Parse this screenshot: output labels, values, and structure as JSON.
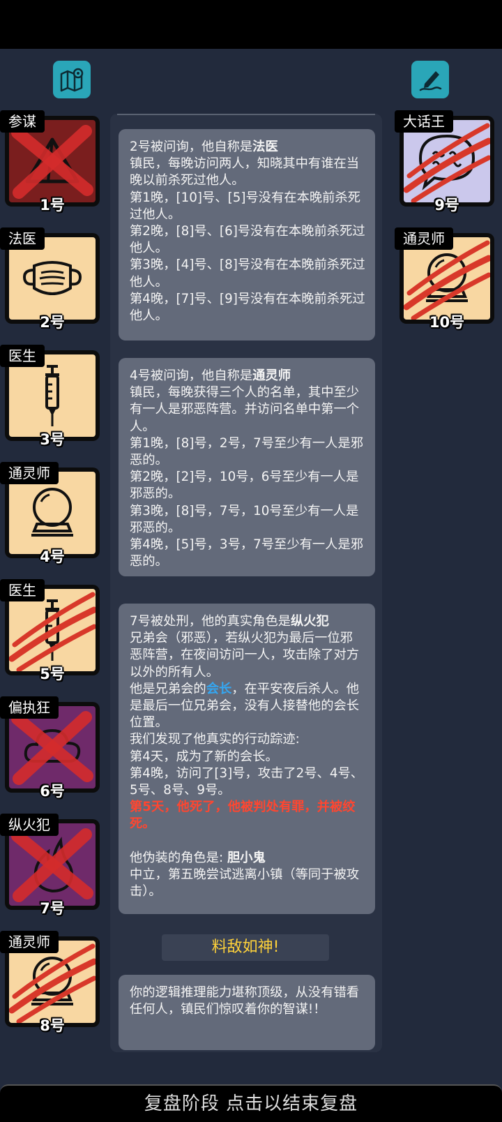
{
  "header": {
    "map_icon": "map-pin-icon",
    "notes_icon": "pencil-note-icon",
    "accent": "#2aa6b8"
  },
  "left_players": [
    {
      "role": "参谋",
      "number": "1号",
      "icon": "pyramid-icon",
      "tile": "evil",
      "status": "crossed"
    },
    {
      "role": "法医",
      "number": "2号",
      "icon": "face-mask-icon",
      "tile": "town",
      "status": "alive"
    },
    {
      "role": "医生",
      "number": "3号",
      "icon": "syringe-icon",
      "tile": "town",
      "status": "alive"
    },
    {
      "role": "通灵师",
      "number": "4号",
      "icon": "crystal-ball-icon",
      "tile": "town",
      "status": "alive"
    },
    {
      "role": "医生",
      "number": "5号",
      "icon": "syringe-icon",
      "tile": "town",
      "status": "slashed"
    },
    {
      "role": "偏执狂",
      "number": "6号",
      "icon": "cloud-icon",
      "tile": "neutral",
      "status": "crossed"
    },
    {
      "role": "纵火犯",
      "number": "7号",
      "icon": "fire-icon",
      "tile": "neutral",
      "status": "crossed"
    },
    {
      "role": "通灵师",
      "number": "8号",
      "icon": "crystal-ball-icon",
      "tile": "town",
      "status": "slashed"
    }
  ],
  "right_players": [
    {
      "role": "大话王",
      "number": "9号",
      "icon": "speech-bubble-icon",
      "tile": "lavender",
      "status": "slashed"
    },
    {
      "role": "通灵师",
      "number": "10号",
      "icon": "crystal-ball-icon",
      "tile": "town",
      "status": "slashed"
    }
  ],
  "log": {
    "msg1": {
      "intro": "2号被问询，他自称是",
      "role": "法医",
      "body": "镇民，每晚访问两人，知晓其中有谁在当晚以前杀死过他人。\n第1晚，[10]号、[5]号没有在本晚前杀死过他人。\n第2晚，[8]号、[6]号没有在本晚前杀死过他人。\n第3晚，[4]号、[8]号没有在本晚前杀死过他人。\n第4晚，[7]号、[9]号没有在本晚前杀死过他人。"
    },
    "msg2": {
      "intro": "4号被问询，他自称是",
      "role": "通灵师",
      "body": "镇民，每晚获得三个人的名单，其中至少有一人是邪恶阵营。并访问名单中第一个人。\n第1晚，[8]号，2号，7号至少有一人是邪恶的。\n第2晚，[2]号，10号，6号至少有一人是邪恶的。\n第3晚，[8]号，7号，10号至少有一人是邪恶的。\n第4晚，[5]号，3号，7号至少有一人是邪恶的。"
    },
    "msg3": {
      "intro": "7号被处刑，他的真实角色是",
      "role": "纵火犯",
      "body1": "兄弟会（邪恶），若纵火犯为最后一位邪恶阵营，在夜间访问一人，攻击除了对方以外的所有人。\n他是兄弟会的",
      "leader": "会长",
      "body2": "，在平安夜后杀人。他是最后一位兄弟会，没有人接替他的会长位置。\n我们发现了他真实的行动踪迹:\n第4天，成为了新的会长。\n第4晚，访问了[3]号，攻击了2号、4号、5号、8号、9号。\n",
      "death": "第5天，他死了，他被判处有罪，并被绞死。",
      "disguise_intro": "他伪装的角色是: ",
      "disguise_role": "胆小鬼",
      "disguise_body": "中立，第五晚尝试逃离小镇（等同于被攻击）。"
    },
    "rating": "料敌如神!",
    "msg4": "你的逻辑推理能力堪称顶级，从没有错看任何人，镇民们惊叹着你的智谋!！"
  },
  "footer": {
    "label": "复盘阶段 点击以结束复盘"
  }
}
